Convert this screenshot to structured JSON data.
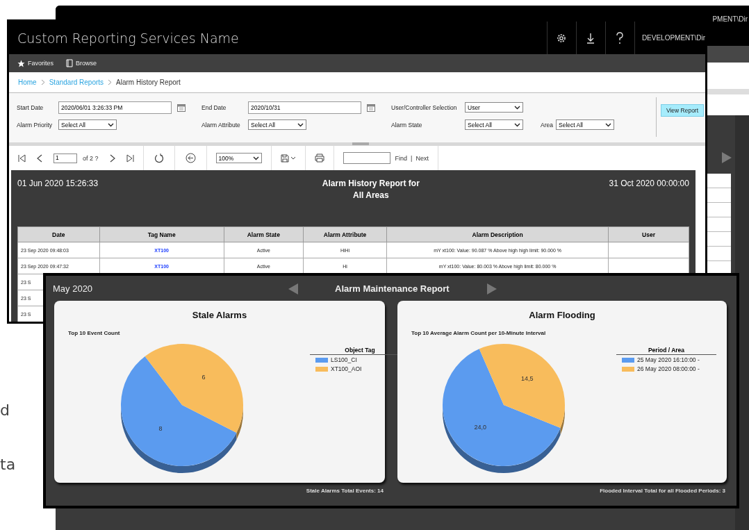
{
  "page_text": [
    "d",
    "ta"
  ],
  "background_window": {
    "user": "PMENT\\Dir"
  },
  "report_portal": {
    "title": "Custom Reporting Services Name",
    "user": "DEVELOPMENT\\Dir",
    "nav": [
      {
        "kind": "star",
        "label": "Favorites"
      },
      {
        "kind": "page",
        "label": "Browse"
      }
    ],
    "breadcrumb": [
      {
        "label": "Home",
        "link": true
      },
      {
        "label": "Standard Reports",
        "link": true
      },
      {
        "label": "Alarm History Report",
        "link": false
      }
    ],
    "parameter_rows": [
      [
        {
          "label": "Start Date",
          "kind": "date",
          "value": "2020/06/01 3:26:33 PM"
        },
        {
          "label": "End Date",
          "kind": "date",
          "value": "2020/10/31"
        },
        {
          "label": "User/Controller Selection",
          "kind": "select",
          "value": "User"
        }
      ],
      [
        {
          "label": "Alarm Priority",
          "kind": "select",
          "value": "Select All"
        },
        {
          "label": "Alarm Attribute",
          "kind": "select",
          "value": "Select All"
        },
        {
          "label": "Alarm State",
          "kind": "select",
          "value": "Select All"
        },
        {
          "label": "Area",
          "kind": "select",
          "value": "Select All"
        }
      ]
    ],
    "view_report_button": "View Report",
    "toolbar": {
      "page": "1",
      "page_count": "of 2 ?",
      "zoom": "100%",
      "find": "Find",
      "separator": "|",
      "next": "Next"
    },
    "report": {
      "start": "01 Jun 2020 15:26:33",
      "title": "Alarm History Report for",
      "subtitle": "All Areas",
      "end": "31 Oct 2020 00:00:00",
      "columns": [
        "Date",
        "Tag Name",
        "Alarm State",
        "Alarm Attribute",
        "Alarm Description",
        "User"
      ],
      "rows": [
        [
          "23 Sep 2020 09:48:03",
          "XT100",
          "Active",
          "HiHi",
          "mY xt100: Value: 90.087 % Above high high limit: 90.000 %"
        ],
        [
          "23 Sep 2020 09:47:32",
          "XT100",
          "Active",
          "Hi",
          "mY xt100: Value: 80.003 % Above high limit: 80.000 %"
        ],
        [
          "23 S"
        ],
        [
          "23 S"
        ],
        [
          "23 S"
        ]
      ]
    }
  },
  "maintenance_report": {
    "period": "May 2020",
    "title": "Alarm Maintenance Report",
    "panels": [
      {
        "title": "Stale Alarms",
        "subtitle": "Top 10 Event Count",
        "legend_title": "Object Tag",
        "legend": [
          {
            "color": "#5b9bef"
          },
          {
            "color": "#f8bc5c"
          }
        ],
        "chart_data": {
          "type": "pie",
          "categories": [
            "LS100_CI",
            "XT100_AOI"
          ],
          "values": [
            8,
            6
          ],
          "value_labels": [
            "8",
            "6"
          ]
        },
        "footer": "Stale Alarms Total Events: 14"
      },
      {
        "title": "Alarm Flooding",
        "subtitle": "Top 10 Average Alarm Count per 10-Minute Interval",
        "legend_title": "Period / Area",
        "legend": [
          {
            "color": "#5b9bef"
          },
          {
            "color": "#f8bc5c"
          }
        ],
        "chart_data": {
          "type": "pie",
          "categories": [
            "25 May 2020 16:10:00 -",
            "26 May 2020 08:00:00 -"
          ],
          "values": [
            24.0,
            14.5
          ],
          "value_labels": [
            "24,0",
            "14,5"
          ]
        },
        "footer": "Flooded Interval Total for all Flooded Periods: 3"
      }
    ]
  }
}
